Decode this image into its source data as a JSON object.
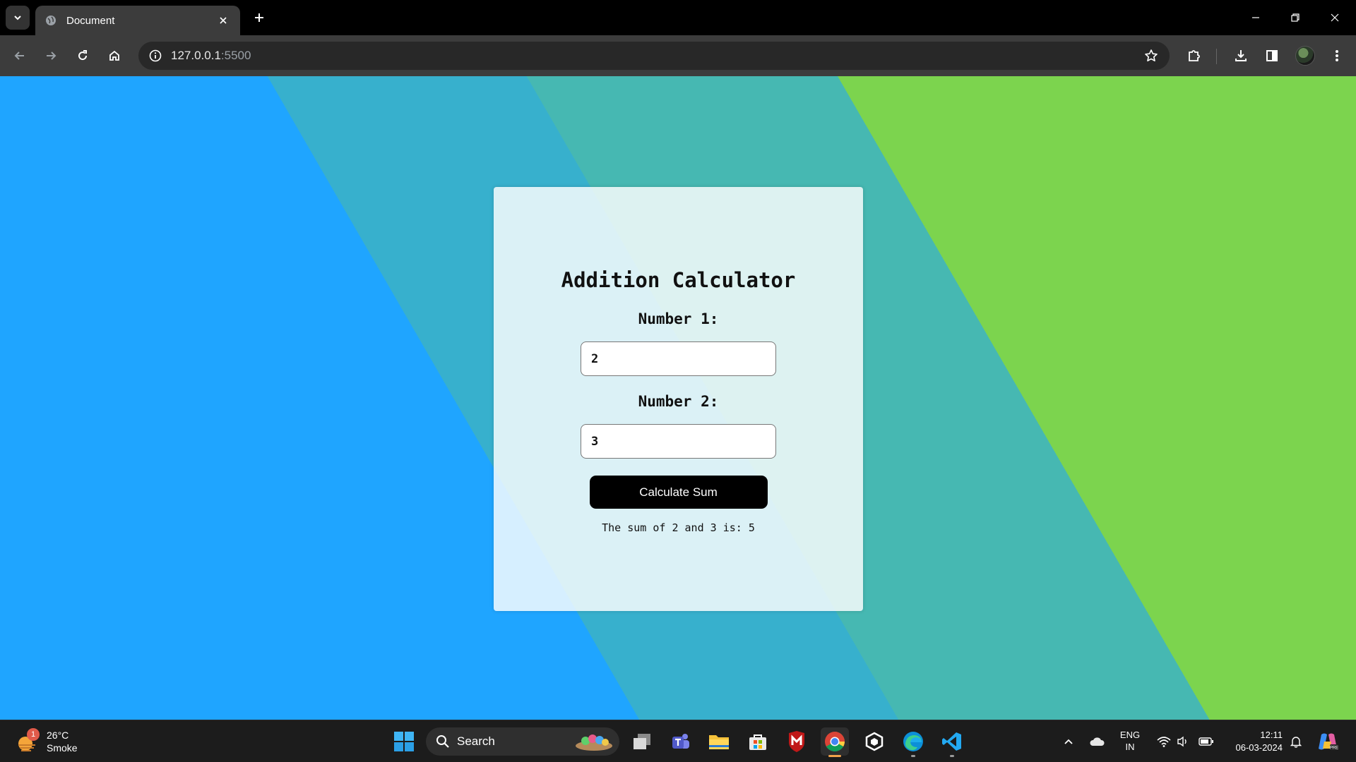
{
  "browser": {
    "tab_title": "Document",
    "url_host": "127.0.0.1",
    "url_port": ":5500"
  },
  "page": {
    "title": "Addition Calculator",
    "number1_label": "Number 1:",
    "number1_value": "2",
    "number2_label": "Number 2:",
    "number2_value": "3",
    "button_label": "Calculate Sum",
    "result_text": "The sum of 2 and 3 is: 5"
  },
  "taskbar": {
    "weather_badge": "1",
    "weather_temp": "26°C",
    "weather_desc": "Smoke",
    "search_label": "Search",
    "lang_line1": "ENG",
    "lang_line2": "IN",
    "time": "12:11",
    "date": "06-03-2024",
    "icons": [
      "task-view-icon",
      "teams-icon",
      "file-explorer-icon",
      "ms-store-icon",
      "mcafee-icon",
      "chrome-icon",
      "app-icon",
      "edge-icon",
      "vscode-icon"
    ]
  },
  "colors": {
    "bg_blue": "#1fa5ff",
    "bg_teal": "#37b0cd",
    "bg_seafoam": "#46b8b2",
    "bg_green": "#7cd44e",
    "button_bg": "#000000"
  }
}
